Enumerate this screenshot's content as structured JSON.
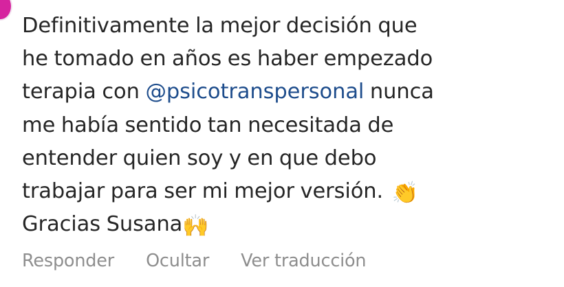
{
  "comment": {
    "lines": [
      "Definitivamente la mejor decisión que",
      "he tomado en años es haber empezado",
      "terapia con ",
      " nunca",
      "me había sentido tan necesitada de",
      "entender quien soy y en que debo",
      "trabajar para ser mi mejor versión. ",
      "Gracias Susana"
    ],
    "mention": "@psicotranspersonal",
    "emoji_clap": "👏",
    "emoji_raised_hands": "🙌",
    "mention_color": "#1e4d8c",
    "text_color": "#262626"
  },
  "actions": {
    "reply": "Responder",
    "hide": "Ocultar",
    "translate": "Ver traducción"
  },
  "colors": {
    "avatar_ring": "#d6249f",
    "action_text": "#8e8e8e"
  }
}
